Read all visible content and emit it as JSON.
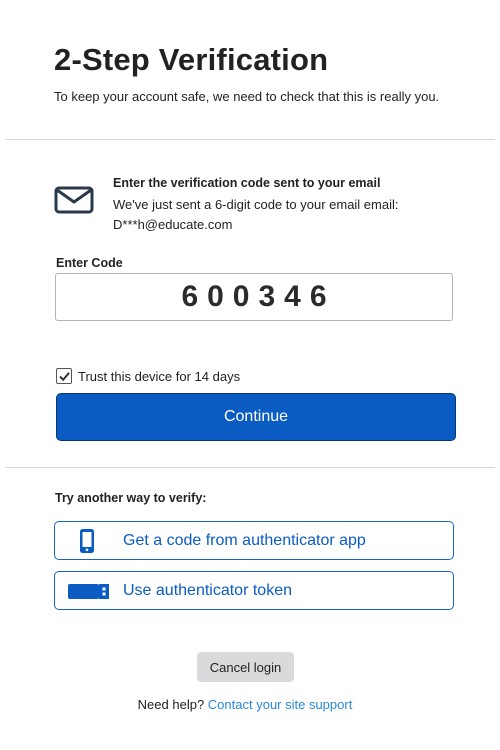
{
  "header": {
    "title": "2-Step Verification",
    "subtitle": "To keep your account safe, we need to check that this is really you."
  },
  "email_section": {
    "icon": "envelope-icon",
    "heading": "Enter the verification code sent to your email",
    "line1": "We've just sent a 6-digit code to your email email:",
    "line2": "D***h@educate.com"
  },
  "code": {
    "label": "Enter Code",
    "value": "600346"
  },
  "trust": {
    "checked": true,
    "label": "Trust this device for 14 days"
  },
  "continue_label": "Continue",
  "alternatives": {
    "heading": "Try another way to verify:",
    "items": [
      {
        "icon": "smartphone-icon",
        "label": "Get a code from authenticator app"
      },
      {
        "icon": "usb-token-icon",
        "label": "Use authenticator token"
      }
    ]
  },
  "cancel_label": "Cancel login",
  "help": {
    "text": "Need help?",
    "link": "Contact your site support"
  },
  "colors": {
    "primary": "#0b5cc2",
    "link": "#2b88d8",
    "cancel_bg": "#d9dadc"
  }
}
